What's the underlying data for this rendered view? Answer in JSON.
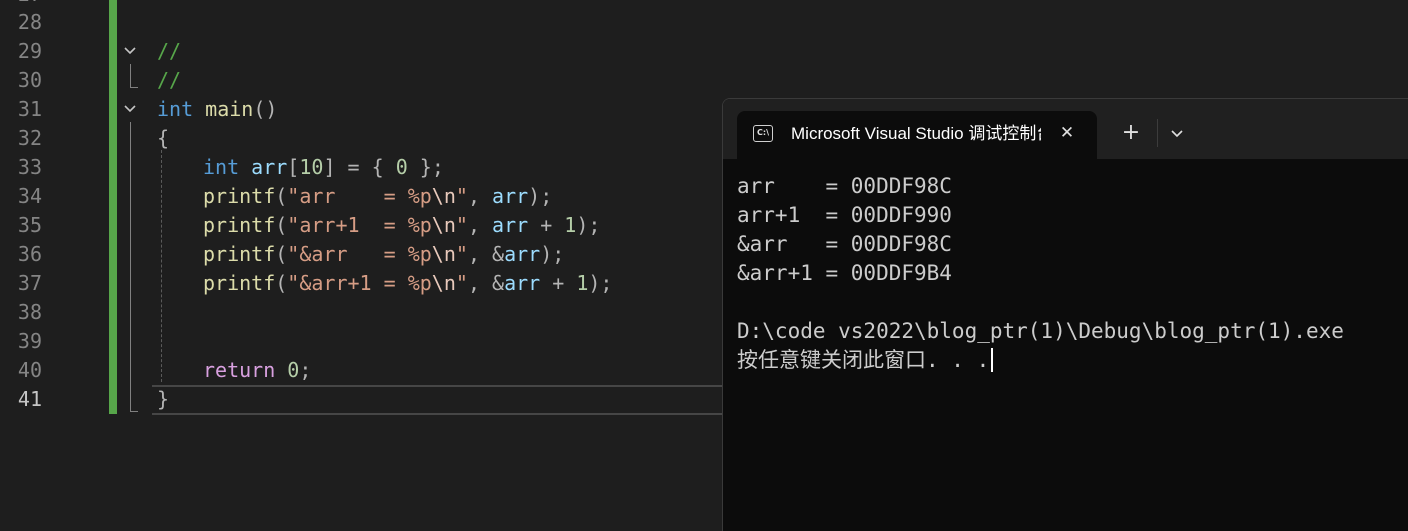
{
  "editor": {
    "line_numbers": [
      "28",
      "29",
      "30",
      "31",
      "32",
      "33",
      "34",
      "35",
      "36",
      "37",
      "38",
      "39",
      "40",
      "41"
    ],
    "active_line": "41",
    "code": {
      "l29_comment": "//",
      "l30_comment": "//",
      "l31": {
        "type": "int",
        "name": "main",
        "parens": "()"
      },
      "l32_brace": "{",
      "l33": {
        "type": "int",
        "var": "arr",
        "open": "[",
        "size": "10",
        "rest": "] = { ",
        "zero": "0",
        "end": " };"
      },
      "l34": {
        "fn": "printf",
        "open": "(",
        "str": "\"arr    = %p",
        "esc": "\\n",
        "strend": "\"",
        "sep": ", ",
        "arg": "arr",
        "end": ");"
      },
      "l35": {
        "fn": "printf",
        "open": "(",
        "str": "\"arr+1  = %p",
        "esc": "\\n",
        "strend": "\"",
        "sep": ", ",
        "arg": "arr",
        "op": " + ",
        "num": "1",
        "end": ");"
      },
      "l36": {
        "fn": "printf",
        "open": "(",
        "str": "\"&arr   = %p",
        "esc": "\\n",
        "strend": "\"",
        "sep": ", ",
        "amp": "&",
        "arg": "arr",
        "end": ");"
      },
      "l37": {
        "fn": "printf",
        "open": "(",
        "str": "\"&arr+1 = %p",
        "esc": "\\n",
        "strend": "\"",
        "sep": ", ",
        "amp": "&",
        "arg": "arr",
        "op": " + ",
        "num": "1",
        "end": ");"
      },
      "l40": {
        "kw": "return",
        "num": "0",
        "end": ";"
      },
      "l41_brace": "}"
    }
  },
  "terminal": {
    "tab_title": "Microsoft Visual Studio 调试控制台",
    "tab_icon_text": "C:\\",
    "close_glyph": "✕",
    "new_tab_glyph": "+",
    "icons": [
      "console-icon",
      "close-icon",
      "plus-icon",
      "chevron-down-icon"
    ],
    "output_lines": [
      "arr    = 00DDF98C",
      "arr+1  = 00DDF990",
      "&arr   = 00DDF98C",
      "&arr+1 = 00DDF9B4",
      "",
      "D:\\code vs2022\\blog_ptr(1)\\Debug\\blog_ptr(1).exe",
      "按任意键关闭此窗口. . ."
    ]
  },
  "colors": {
    "editor_bg": "#1e1e1e",
    "terminal_bg": "#0c0c0c",
    "change_bar": "#57a64a",
    "keyword": "#569cd6",
    "function": "#dcdcaa",
    "string": "#d69d85"
  }
}
